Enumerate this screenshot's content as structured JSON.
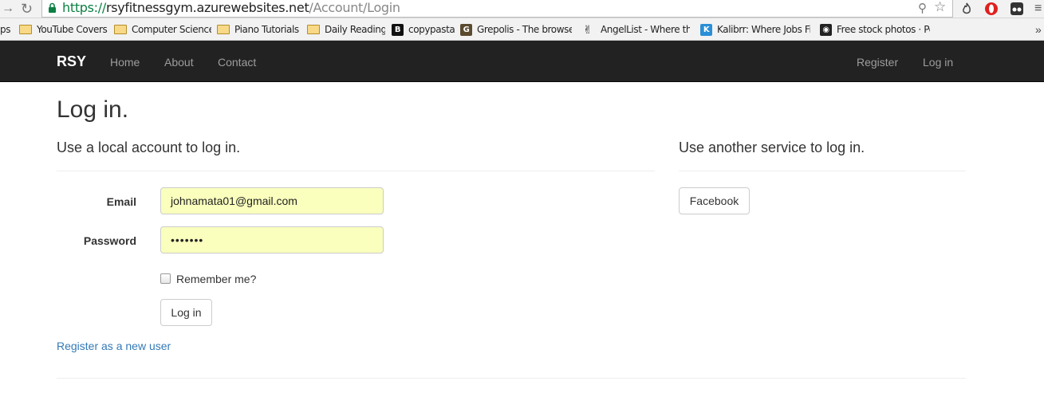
{
  "browser": {
    "url_scheme": "https://",
    "url_host": "rsyfitnessgym.azurewebsites.net",
    "url_path": "/Account/Login",
    "bookmarks": [
      {
        "label": "ps",
        "icon": "apps-icon"
      },
      {
        "label": "YouTube Covers",
        "icon": "folder-icon"
      },
      {
        "label": "Computer Science",
        "icon": "folder-icon"
      },
      {
        "label": "Piano Tutorials",
        "icon": "folder-icon"
      },
      {
        "label": "Daily Reading",
        "icon": "folder-icon"
      },
      {
        "label": "copypasta",
        "icon": "pastebin-icon"
      },
      {
        "label": "Grepolis - The browse",
        "icon": "grepolis-icon"
      },
      {
        "label": "AngelList - Where the",
        "icon": "angellist-icon"
      },
      {
        "label": "Kalibrr: Where Jobs Fi",
        "icon": "kalibrr-icon"
      },
      {
        "label": "Free stock photos · Pe",
        "icon": "camera-icon"
      }
    ]
  },
  "navbar": {
    "brand": "RSY",
    "links": [
      "Home",
      "About",
      "Contact"
    ],
    "right_links": [
      "Register",
      "Log in"
    ]
  },
  "page": {
    "title": "Log in.",
    "local_heading": "Use a local account to log in.",
    "external_heading": "Use another service to log in.",
    "email_label": "Email",
    "email_value": "johnamata01@gmail.com",
    "password_label": "Password",
    "password_value": "•••••••",
    "remember_label": "Remember me?",
    "login_button": "Log in",
    "register_link": "Register as a new user",
    "facebook_button": "Facebook"
  },
  "colors": {
    "navbar_bg": "#222222",
    "autofill_bg": "#faffbd",
    "link": "#337ab7",
    "secure_green": "#0b8043"
  }
}
